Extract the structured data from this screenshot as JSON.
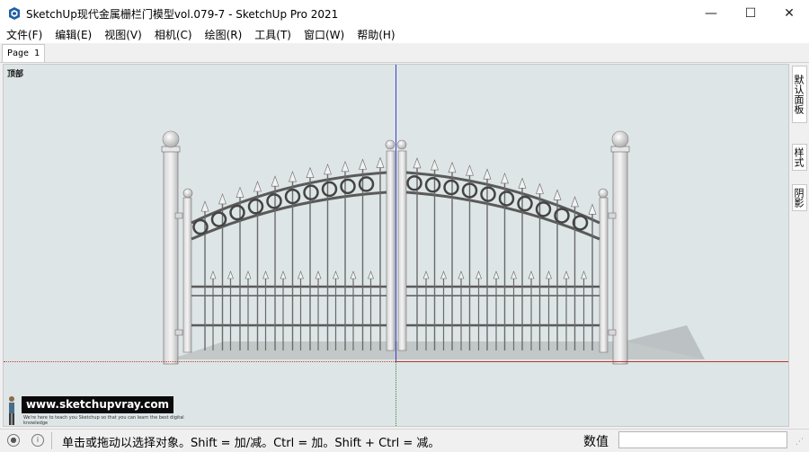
{
  "window": {
    "title": "SketchUp现代金属栅栏门模型vol.079-7 - SketchUp Pro 2021",
    "minimize_glyph": "—",
    "maximize_glyph": "☐",
    "close_glyph": "✕"
  },
  "menu": [
    "文件(F)",
    "编辑(E)",
    "视图(V)",
    "相机(C)",
    "绘图(R)",
    "工具(T)",
    "窗口(W)",
    "帮助(H)"
  ],
  "tabs": [
    {
      "label": "Page 1",
      "active": true
    }
  ],
  "viewport": {
    "scene_label": "顶部",
    "background": "#dee5e6"
  },
  "watermark": {
    "main": "www.sketchupvray.com",
    "sub": "We're here to teach you Sketchup so that you can learn the best digital knowledge"
  },
  "right_tray": [
    "默认面板",
    "样式",
    "阴影"
  ],
  "status": {
    "info_icon": "i",
    "message": "单击或拖动以选择对象。Shift = 加/减。Ctrl = 加。Shift + Ctrl = 减。",
    "vcb_label": "数值",
    "vcb_value": ""
  },
  "colors": {
    "axis_blue": "#3b3fd0",
    "axis_red": "#c03030",
    "axis_green": "#3a8a3a",
    "gate_metal": "#ececec",
    "gate_shadow": "#b8bcbd"
  }
}
